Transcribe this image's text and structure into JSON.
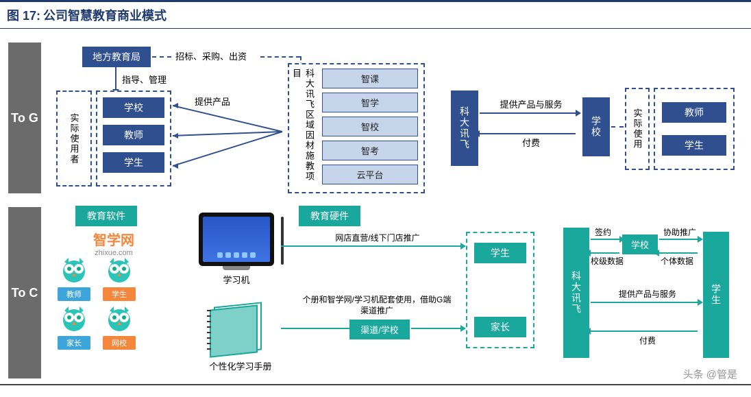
{
  "title_prefix": "图 17:",
  "title_text": "公司智慧教育商业模式",
  "bands": {
    "tog": "To G",
    "toc": "To C"
  },
  "tog": {
    "edu_bureau": "地方教育局",
    "edu_bureau_note": "招标、采购、出资",
    "guide": "指导、管理",
    "users_label": "实际使用者",
    "school": "学校",
    "teacher": "教师",
    "student": "学生",
    "provide_product": "提供产品",
    "kedaxunfei_project": "科大讯飞区域因材施教项目",
    "products": [
      "智课",
      "智学",
      "智校",
      "智考",
      "云平台"
    ],
    "kdxf": "科大讯飞",
    "provide_service": "提供产品与服务",
    "pay": "付费",
    "school_right": "学校",
    "actual_use": "实际使用",
    "teacher_r": "教师",
    "student_r": "学生"
  },
  "toc": {
    "edu_software": "教育软件",
    "edu_hardware": "教育硬件",
    "zhixue": "智学网",
    "zhixue_url": "zhixue.com",
    "tags": {
      "teacher": "教师",
      "student": "学生",
      "parent": "家长",
      "netschool": "网校"
    },
    "tablet_label": "学习机",
    "booklet_label": "个性化学习手册",
    "store_promo": "网店直营/线下门店推广",
    "channel": "渠道/学校",
    "bundle": "个册和智学网/学习机配套使用，借助G端渠道推广",
    "student_box": "学生",
    "parent_box": "家长",
    "kdxf": "科大讯飞",
    "sign": "签约",
    "school_data": "校级数据",
    "indiv_data": "个体数据",
    "assist": "协助推广",
    "school": "学校",
    "provide_service": "提供产品与服务",
    "pay": "付费",
    "student_right": "学生"
  },
  "watermark": "头条 @管是"
}
